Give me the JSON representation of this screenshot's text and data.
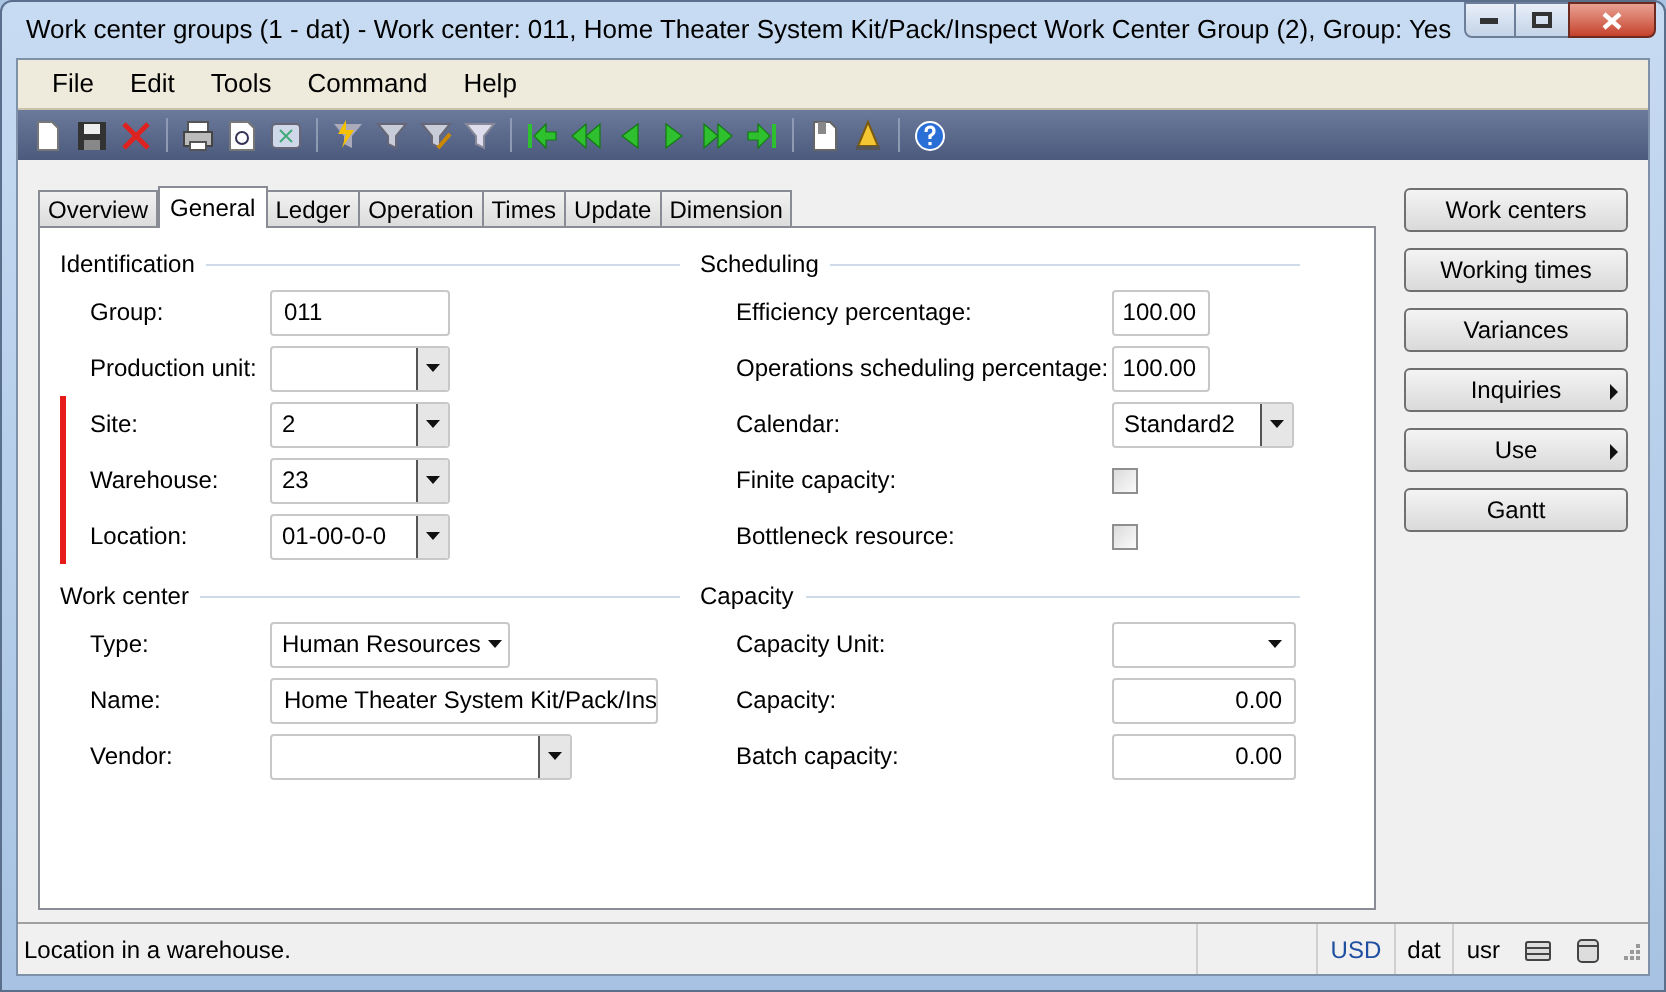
{
  "window": {
    "title": "Work center groups (1 - dat) - Work center: 011, Home Theater System Kit/Pack/Inspect Work Center Group (2), Group: Yes"
  },
  "menu": [
    "File",
    "Edit",
    "Tools",
    "Command",
    "Help"
  ],
  "tabs": [
    {
      "label": "Overview",
      "selected": false
    },
    {
      "label": "General",
      "selected": true
    },
    {
      "label": "Ledger",
      "selected": false
    },
    {
      "label": "Operation",
      "selected": false
    },
    {
      "label": "Times",
      "selected": false
    },
    {
      "label": "Update",
      "selected": false
    },
    {
      "label": "Dimension",
      "selected": false
    }
  ],
  "left_groups": [
    {
      "title": "Identification",
      "fields": [
        {
          "label": "Group:",
          "kind": "text",
          "value": "011",
          "flagged": false
        },
        {
          "label": "Production unit:",
          "kind": "combo",
          "flagged": false
        },
        {
          "label": "Site:",
          "kind": "combo",
          "value": "2",
          "flagged": true
        },
        {
          "label": "Warehouse:",
          "kind": "combo",
          "value": "23",
          "flagged": true
        },
        {
          "label": "Location:",
          "kind": "combo",
          "value": "01-00-0-0",
          "flagged": true
        }
      ]
    },
    {
      "title": "Work center",
      "fields": [
        {
          "label": "Type:",
          "kind": "dropdown",
          "value": "Human Resources",
          "flagged": false
        },
        {
          "label": "Name:",
          "kind": "text",
          "value": "Home Theater System Kit/Pack/Ins",
          "flagged": false
        },
        {
          "label": "Vendor:",
          "kind": "combo",
          "flagged": false
        }
      ]
    }
  ],
  "right_groups": [
    {
      "title": "Scheduling",
      "fields": [
        {
          "label": "Efficiency percentage:",
          "kind": "number",
          "value": "100.00"
        },
        {
          "label": "Operations scheduling percentage:",
          "kind": "number",
          "value": "100.00"
        },
        {
          "label": "Calendar:",
          "kind": "combo",
          "value": "Standard2"
        },
        {
          "label": "Finite capacity:",
          "kind": "checkbox",
          "checked": false
        },
        {
          "label": "Bottleneck resource:",
          "kind": "checkbox",
          "checked": false
        }
      ]
    },
    {
      "title": "Capacity",
      "fields": [
        {
          "label": "Capacity Unit:",
          "kind": "dropdown"
        },
        {
          "label": "Capacity:",
          "kind": "number",
          "value": "0.00"
        },
        {
          "label": "Batch capacity:",
          "kind": "number",
          "value": "0.00"
        }
      ]
    }
  ],
  "buttons": [
    {
      "label": "Work centers",
      "submenu": false
    },
    {
      "label": "Working times",
      "submenu": false
    },
    {
      "label": "Variances",
      "submenu": false
    },
    {
      "label": "Inquiries",
      "submenu": true
    },
    {
      "label": "Use",
      "submenu": true
    },
    {
      "label": "Gantt",
      "submenu": false
    }
  ],
  "status_bar": {
    "message": "Location in a warehouse.",
    "currency": "USD",
    "company": "dat",
    "user": "usr"
  }
}
